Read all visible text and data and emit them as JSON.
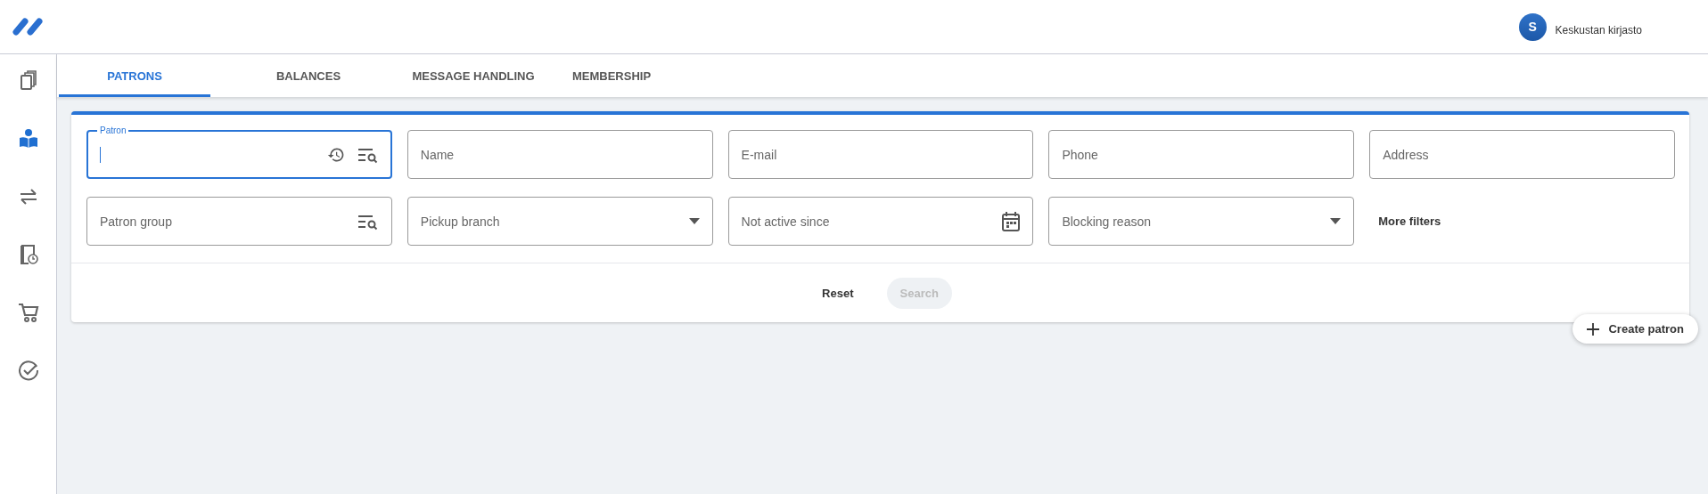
{
  "header": {
    "avatar_initial": "S",
    "user": "Keskustan kirjasto"
  },
  "sidebar": {
    "items": [
      {
        "selected": false
      },
      {
        "selected": true
      },
      {
        "selected": false
      },
      {
        "selected": false
      },
      {
        "selected": false
      },
      {
        "selected": false
      }
    ]
  },
  "tabs": [
    {
      "label": "PATRONS",
      "selected": true
    },
    {
      "label": "BALANCES",
      "selected": false
    },
    {
      "label": "MESSAGE HANDLING",
      "selected": false
    },
    {
      "label": "MEMBERSHIP",
      "selected": false
    }
  ],
  "filters": [
    {
      "label": "Patron",
      "kind": "lookup",
      "focused": true,
      "history": true
    },
    {
      "label": "Name",
      "kind": "text",
      "focused": false
    },
    {
      "label": "E-mail",
      "kind": "text",
      "focused": false
    },
    {
      "label": "Phone",
      "kind": "text",
      "focused": false
    },
    {
      "label": "Address",
      "kind": "text",
      "focused": false
    },
    {
      "label": "Patron group",
      "kind": "lookup",
      "focused": false,
      "history": false
    },
    {
      "label": "Pickup branch",
      "kind": "select",
      "focused": false
    },
    {
      "label": "Not active since",
      "kind": "date",
      "focused": false
    },
    {
      "label": "Blocking reason",
      "kind": "select",
      "focused": false
    }
  ],
  "more_filters": "More filters",
  "actions": {
    "reset": "Reset",
    "search": {
      "label": "Search",
      "disabled": true
    }
  },
  "create_button": "Create patron"
}
